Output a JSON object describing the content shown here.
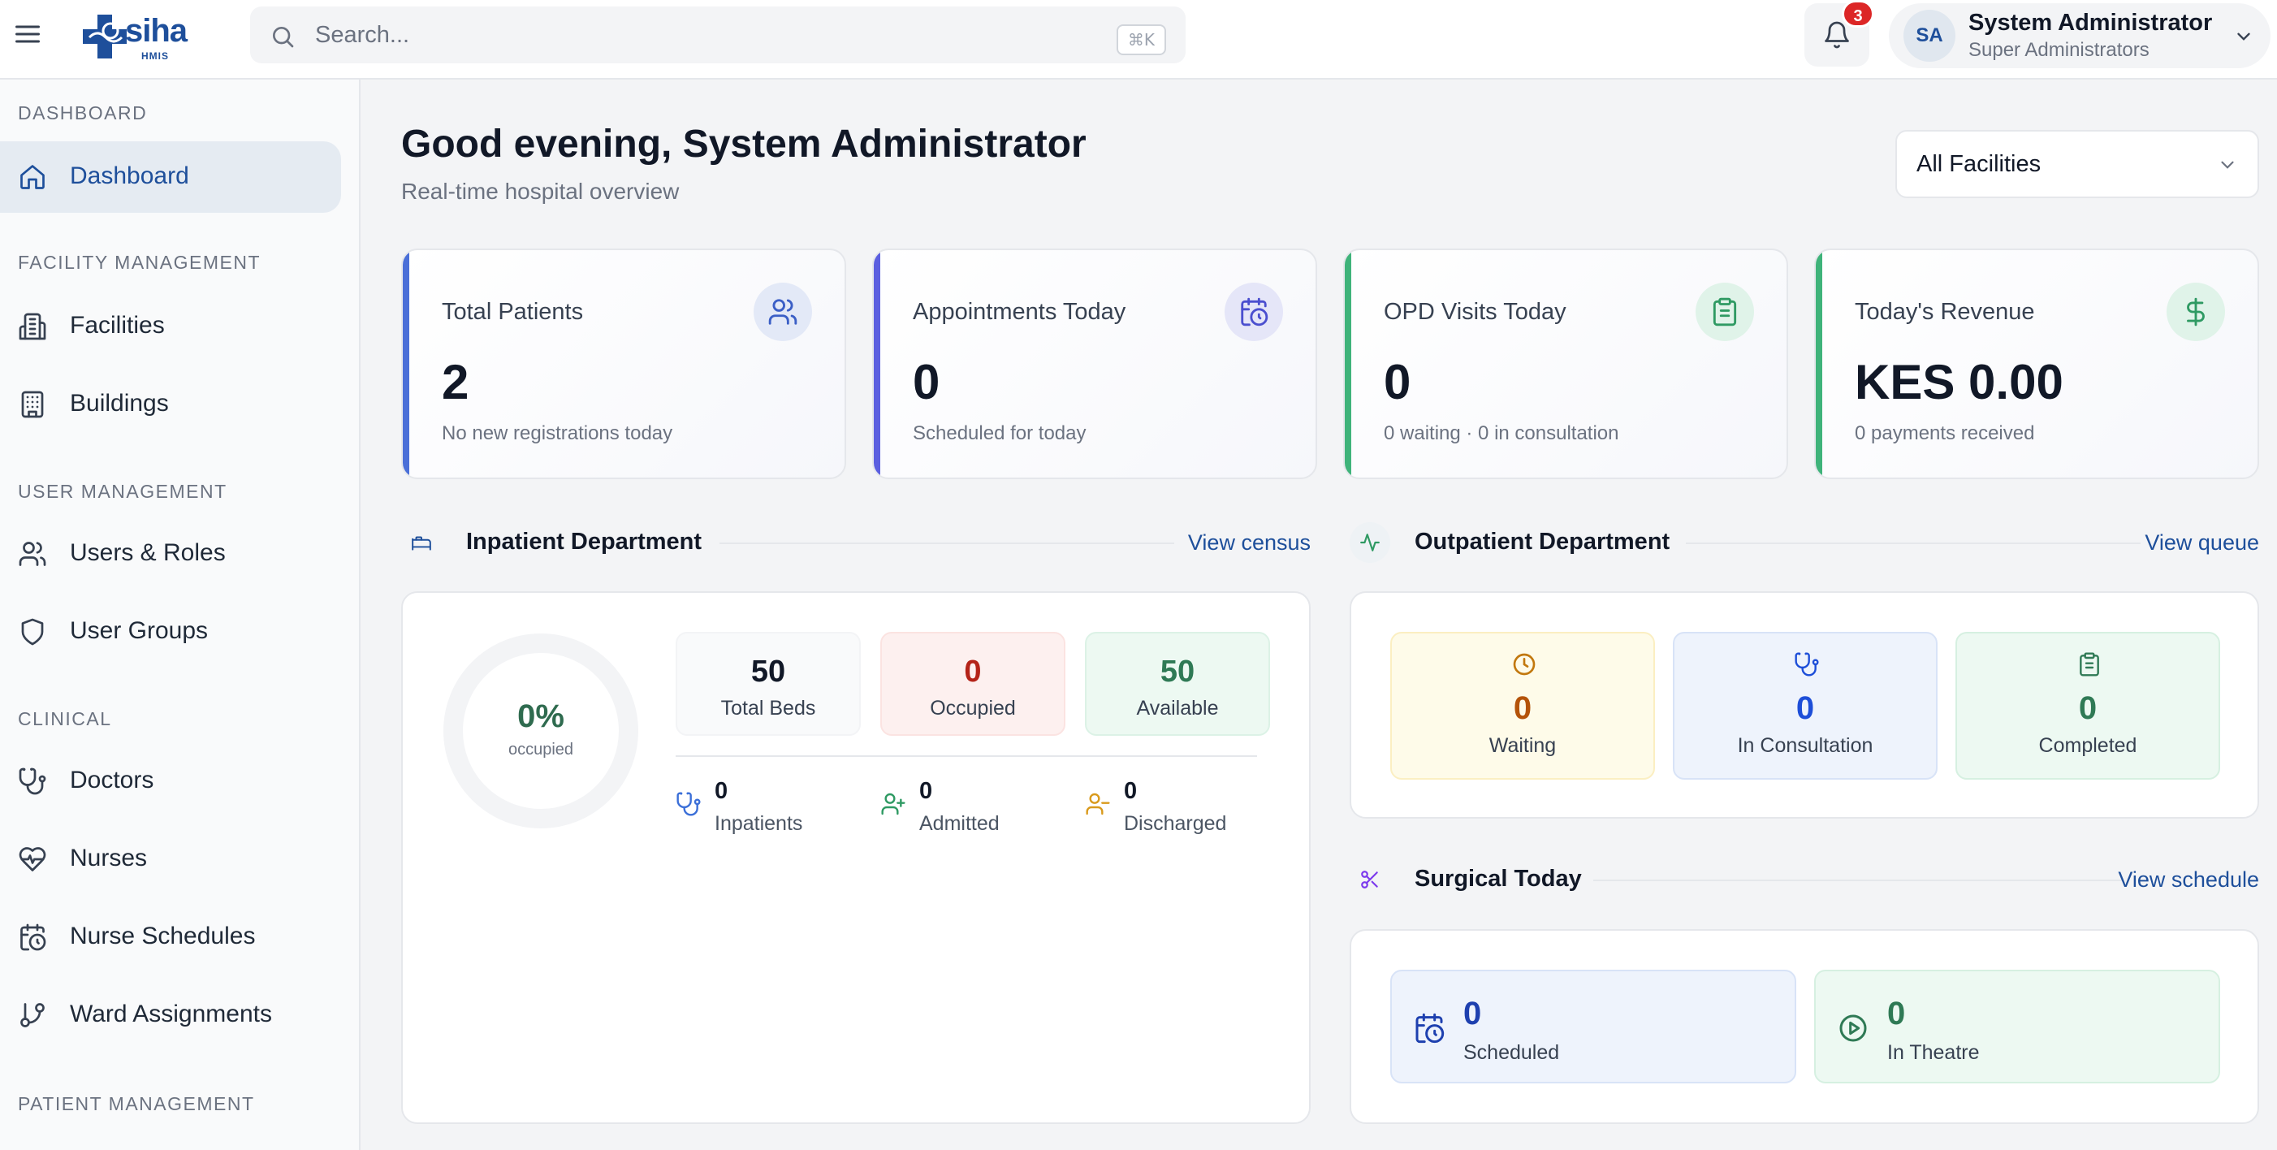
{
  "header": {
    "logo_text": "siha",
    "logo_subtext": "HMIS",
    "search_placeholder": "Search...",
    "search_shortcut": "⌘K",
    "notification_count": "3",
    "user": {
      "initials": "SA",
      "name": "System Administrator",
      "role": "Super Administrators"
    }
  },
  "sidebar": {
    "sections": {
      "dashboard": "DASHBOARD",
      "facility": "FACILITY MANAGEMENT",
      "user": "USER MANAGEMENT",
      "clinical": "CLINICAL",
      "patient": "PATIENT MANAGEMENT"
    },
    "items": {
      "dashboard": "Dashboard",
      "facilities": "Facilities",
      "buildings": "Buildings",
      "users_roles": "Users & Roles",
      "user_groups": "User Groups",
      "doctors": "Doctors",
      "nurses": "Nurses",
      "nurse_schedules": "Nurse Schedules",
      "ward_assignments": "Ward Assignments"
    },
    "active": "dashboard"
  },
  "main": {
    "greeting": "Good evening, System Administrator",
    "subtitle": "Real-time hospital overview",
    "facility_filter": "All Facilities",
    "stats": [
      {
        "label": "Total Patients",
        "value": "2",
        "sub": "No new registrations today",
        "icon": "users-icon",
        "accent": "#4a6fd8"
      },
      {
        "label": "Appointments Today",
        "value": "0",
        "sub": "Scheduled for today",
        "icon": "calendar-clock-icon",
        "accent": "#5b5fe0"
      },
      {
        "label": "OPD Visits Today",
        "value": "0",
        "sub": "0 waiting · 0 in consultation",
        "icon": "clipboard-icon",
        "accent": "#3fb37a"
      },
      {
        "label": "Today's Revenue",
        "value": "KES 0.00",
        "sub": "0 payments received",
        "icon": "dollar-icon",
        "accent": "#3fb37a"
      }
    ],
    "inpatient": {
      "title": "Inpatient Department",
      "link": "View census",
      "occupancy_percent": 0,
      "occupancy_text": "0%",
      "occupancy_label": "occupied",
      "beds": [
        {
          "label": "Total Beds",
          "value": "50",
          "color": "#111827"
        },
        {
          "label": "Occupied",
          "value": "0",
          "color": "#b42318"
        },
        {
          "label": "Available",
          "value": "50",
          "color": "#2f7a55"
        }
      ],
      "patients": [
        {
          "label": "Inpatients",
          "value": "0",
          "icon": "stethoscope-icon"
        },
        {
          "label": "Admitted",
          "value": "0",
          "icon": "user-plus-icon"
        },
        {
          "label": "Discharged",
          "value": "0",
          "icon": "user-minus-icon"
        }
      ]
    },
    "outpatient": {
      "title": "Outpatient Department",
      "link": "View queue",
      "boxes": [
        {
          "label": "Waiting",
          "value": "0",
          "icon": "clock-icon",
          "color": "#b45309"
        },
        {
          "label": "In Consultation",
          "value": "0",
          "icon": "stethoscope-icon",
          "color": "#1d4ed8"
        },
        {
          "label": "Completed",
          "value": "0",
          "icon": "clipboard-icon",
          "color": "#2f7a55"
        }
      ]
    },
    "surgical": {
      "title": "Surgical Today",
      "link": "View schedule",
      "boxes": [
        {
          "label": "Scheduled",
          "value": "0",
          "icon": "calendar-clock-icon",
          "color": "#1e40af"
        },
        {
          "label": "In Theatre",
          "value": "0",
          "icon": "play-circle-icon",
          "color": "#2f7a55"
        }
      ]
    }
  }
}
